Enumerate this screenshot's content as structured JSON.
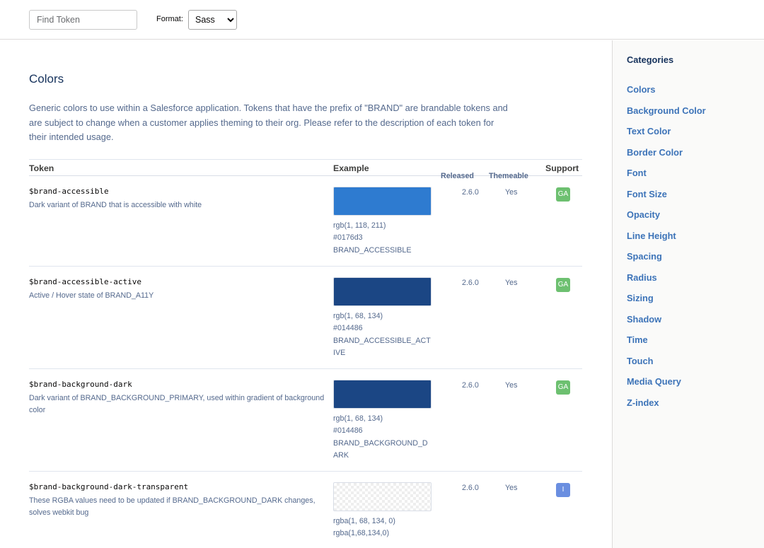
{
  "toolbar": {
    "search_placeholder": "Find Token",
    "format_label": "Format:",
    "format_value": "Sass",
    "format_options": [
      "Sass"
    ]
  },
  "section": {
    "title": "Colors",
    "description": "Generic colors to use within a Salesforce application. Tokens that have the prefix of \"BRAND\" are brandable tokens and are subject to change when a customer applies theming to their org. Please refer to the description of each token for their intended usage."
  },
  "table": {
    "headers": {
      "token": "Token",
      "example": "Example",
      "released": "Released",
      "themeable": "Themeable",
      "support": "Support"
    },
    "rows": [
      {
        "name": "$brand-accessible",
        "description": "Dark variant of BRAND that is accessible with white",
        "color": "#0176d3",
        "swatch_color": "#2e7bd0",
        "values": [
          "rgb(1, 118, 211)",
          "#0176d3",
          "BRAND_ACCESSIBLE"
        ],
        "released": "2.6.0",
        "themeable": "Yes",
        "support": "GA"
      },
      {
        "name": "$brand-accessible-active",
        "description": "Active / Hover state of BRAND_A11Y",
        "color": "#014486",
        "swatch_color": "#1b4684",
        "values": [
          "rgb(1, 68, 134)",
          "#014486",
          "BRAND_ACCESSIBLE_ACTIVE"
        ],
        "released": "2.6.0",
        "themeable": "Yes",
        "support": "GA"
      },
      {
        "name": "$brand-background-dark",
        "description": "Dark variant of BRAND_BACKGROUND_PRIMARY, used within gradient of background color",
        "color": "#014486",
        "swatch_color": "#1b4684",
        "values": [
          "rgb(1, 68, 134)",
          "#014486",
          "BRAND_BACKGROUND_DARK"
        ],
        "released": "2.6.0",
        "themeable": "Yes",
        "support": "GA"
      },
      {
        "name": "$brand-background-dark-transparent",
        "description": "These RGBA values need to be updated if BRAND_BACKGROUND_DARK changes, solves webkit bug",
        "color": "transparent",
        "swatch_color": "transparent",
        "values": [
          "rgba(1, 68, 134, 0)",
          "rgba(1,68,134,0)"
        ],
        "released": "2.6.0",
        "themeable": "Yes",
        "support": "I"
      }
    ]
  },
  "sidebar": {
    "title": "Categories",
    "items": [
      "Colors",
      "Background Color",
      "Text Color",
      "Border Color",
      "Font",
      "Font Size",
      "Opacity",
      "Line Height",
      "Spacing",
      "Radius",
      "Sizing",
      "Shadow",
      "Time",
      "Touch",
      "Media Query",
      "Z-index"
    ]
  },
  "colors": {
    "heading": "#16325c",
    "link": "#3c73b8",
    "muted_text": "#54698d",
    "badge_ga": "#6dc070",
    "badge_i": "#6a8ee0"
  }
}
